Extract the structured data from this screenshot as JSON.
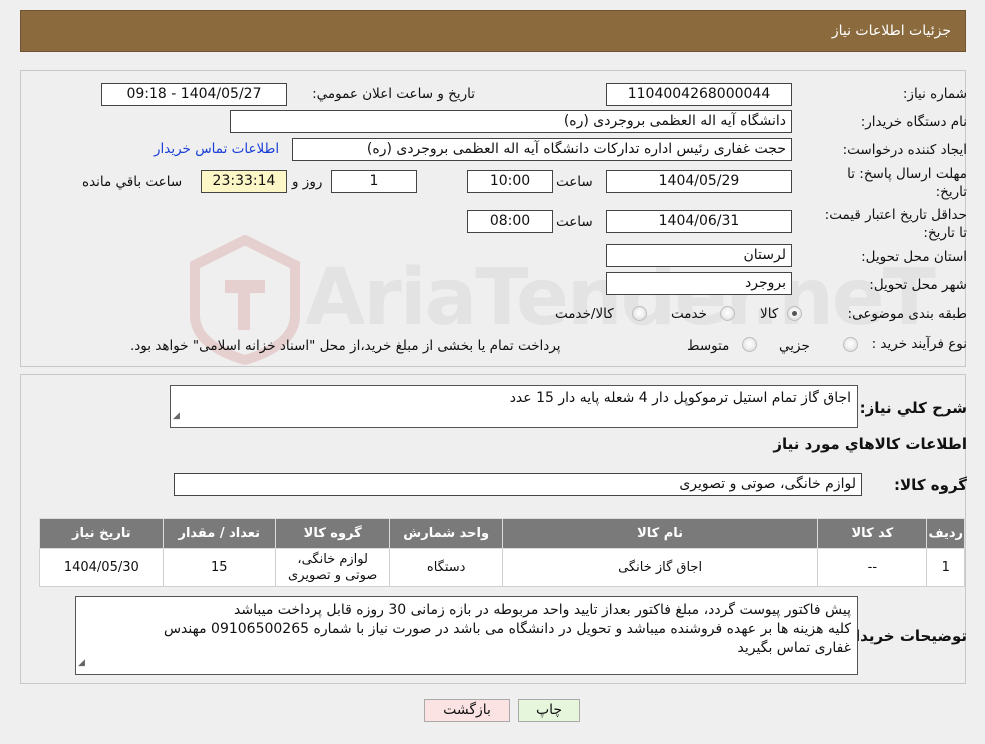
{
  "page": {
    "title": "جزئيات اطلاعات نياز"
  },
  "fields": {
    "need_number": {
      "label": "شماره نياز:",
      "value": "1104004268000044"
    },
    "announce_datetime": {
      "label": "تاريخ و ساعت اعلان عمومي:",
      "value": "1404/05/27 - 09:18"
    },
    "buyer_org": {
      "label": "نام دستگاه خريدار:",
      "value": "دانشگاه آيه اله العظمی بروجردی (ره)"
    },
    "requester": {
      "label": "ايجاد کننده درخواست:",
      "value": "حجت غفاری رئیس اداره تدارکات  دانشگاه آيه اله العظمی بروجردی (ره)"
    },
    "contact_link": "اطلاعات تماس خريدار",
    "deadline": {
      "label": "مهلت ارسال پاسخ: تا تاريخ:",
      "date": "1404/05/29",
      "time_label": "ساعت",
      "time": "10:00",
      "days": "1",
      "days_label": "روز و",
      "remaining": "23:33:14",
      "remaining_label": "ساعت باقي مانده"
    },
    "price_validity": {
      "label": "حداقل تاريخ اعتبار قيمت: تا تاريخ:",
      "date": "1404/06/31",
      "time_label": "ساعت",
      "time": "08:00"
    },
    "province": {
      "label": "استان محل تحويل:",
      "value": "لرستان"
    },
    "city": {
      "label": "شهر محل تحويل:",
      "value": "بروجرد"
    },
    "category": {
      "label": "طبقه بندی موضوعی:",
      "options": [
        "کالا",
        "خدمت",
        "کالا/خدمت"
      ],
      "selected": "کالا"
    },
    "purchase_type": {
      "label": "نوع فرآيند خريد :",
      "options": [
        "جزيي",
        "متوسط"
      ],
      "selected": "",
      "note": "پرداخت تمام يا بخشی از مبلغ خريد،از محل \"اسناد خزانه اسلامی\" خواهد بود."
    }
  },
  "summary": {
    "label": "شرح کلي نياز:",
    "value": "اجاق گاز تمام استیل ترموکوپل دار 4 شعله پایه دار 15 عدد"
  },
  "goods_section": {
    "title": "اطلاعات کالاهاي مورد نياز"
  },
  "goods_group": {
    "label": "گروه کالا:",
    "value": "لوازم خانگی، صوتی و تصویری"
  },
  "table": {
    "headers": [
      "رديف",
      "کد کالا",
      "نام کالا",
      "واحد شمارش",
      "گروه کالا",
      "تعداد / مقدار",
      "تاريخ نياز"
    ],
    "rows": [
      [
        "1",
        "--",
        "اجاق گاز خانگی",
        "دستگاه",
        "لوازم خانگی، صوتی و تصویری",
        "15",
        "1404/05/30"
      ]
    ]
  },
  "buyer_notes": {
    "label": "توضيحات خريدار:",
    "lines": [
      "پیش فاکتور پیوست گردد، مبلغ فاکتور بعداز تایید واحد مربوطه در بازه زمانی 30 روزه قابل پرداخت میباشد",
      "کلیه هزینه ها بر عهده فروشنده میباشد و تحویل در دانشگاه می باشد در صورت نیاز با شماره 09106500265 مهندس",
      "غفاری تماس بگیرید"
    ]
  },
  "buttons": {
    "print": "چاپ",
    "back": "بازگشت"
  },
  "watermark": {
    "text": "AriaTender.neT"
  },
  "colors": {
    "header_bg": "#8b6a3e",
    "table_header_bg": "#7a7a7a",
    "link": "#1a3fd6",
    "back_btn_bg": "#fbe3e3",
    "print_btn_bg": "#e6f6dd",
    "timer_bg": "#fdf7c7"
  }
}
